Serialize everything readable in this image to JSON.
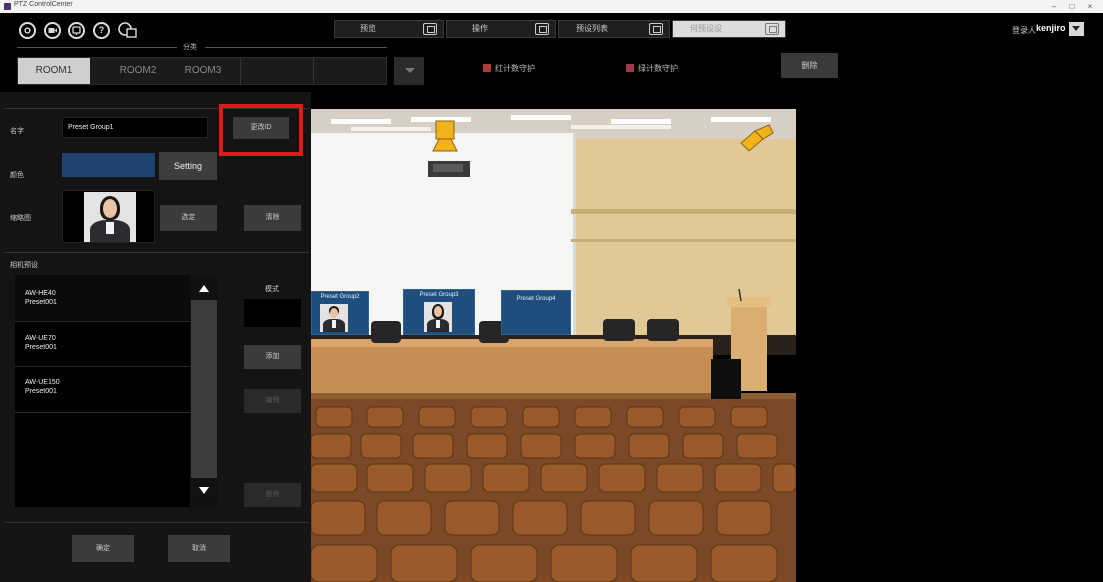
{
  "window": {
    "title": "PTZ ControlCenter",
    "minimize": "–",
    "maximize": "□",
    "close": "×"
  },
  "toolbar": {
    "icons": [
      "power-icon",
      "camera-icon",
      "camera-settings-icon",
      "help-icon",
      "copy-window-icon"
    ],
    "help_glyph": "?",
    "tabs": [
      {
        "label": "预览",
        "active": false
      },
      {
        "label": "操作",
        "active": false
      },
      {
        "label": "预设列表",
        "active": false
      },
      {
        "label": "何预设设",
        "active": true
      }
    ],
    "login_label": "登录人",
    "login_user": "kenjiro"
  },
  "category": {
    "label": "分类",
    "rooms": [
      {
        "label": "ROOM1",
        "active": true
      },
      {
        "label": "ROOM2",
        "active": false
      },
      {
        "label": "ROOM3",
        "active": false
      }
    ],
    "red_count_label": "红计数守护",
    "green_count_label": "绿计数守护",
    "delete_label": "删除",
    "red_color": "#b03a3a",
    "green_color": "#9b3b4c"
  },
  "form": {
    "name_label": "名字",
    "name_value": "Preset Group1",
    "rename_button": "更改ID",
    "color_label": "颜色",
    "color_value": "#1e4373",
    "setting_button": "Setting",
    "thumb_label": "缩略图",
    "select_button": "选定",
    "delete_thumb_button": "清除",
    "camera_preset_label": "相机预设",
    "mode_label": "模式",
    "add_button": "添加",
    "edit_button": "编辑",
    "remove_button": "删除",
    "ok_button": "确定",
    "cancel_button": "取消"
  },
  "presets": [
    {
      "camera": "AW-HE40",
      "preset": "Preset001"
    },
    {
      "camera": "AW-UE70",
      "preset": "Preset001"
    },
    {
      "camera": "AW-UE150",
      "preset": "Preset001"
    }
  ],
  "room_view": {
    "preset_cards": [
      {
        "label": "Preset Group2"
      },
      {
        "label": "Preset Group3"
      },
      {
        "label": "Preset Group4"
      }
    ],
    "camera_color": "#f2b21c"
  }
}
